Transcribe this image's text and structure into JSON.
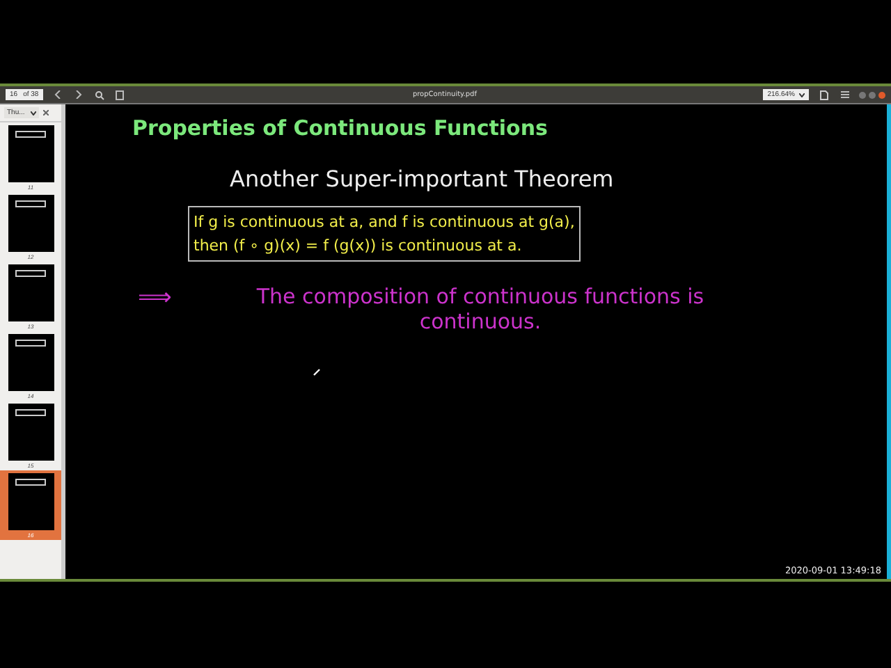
{
  "toolbar": {
    "page_number": "16",
    "page_count": "of 38",
    "file_name": "propContinuity.pdf",
    "zoom": "216.64%"
  },
  "sidebar": {
    "view_selector": "Thu...",
    "thumbnails": [
      {
        "label": "11",
        "selected": false
      },
      {
        "label": "12",
        "selected": false
      },
      {
        "label": "13",
        "selected": false
      },
      {
        "label": "14",
        "selected": false
      },
      {
        "label": "15",
        "selected": false
      },
      {
        "label": "16",
        "selected": true
      }
    ]
  },
  "slide": {
    "title": "Properties of Continuous Functions",
    "subtitle": "Another Super-important Theorem",
    "theorem_lines": [
      "If g is continuous at a, and f is continuous at g(a),",
      "then (f ∘ g)(x) = f (g(x)) is continuous at a."
    ],
    "implies": "⟹",
    "conclusion": "The composition of continuous functions is continuous."
  },
  "timestamp": "2020-09-01  13:49:18"
}
